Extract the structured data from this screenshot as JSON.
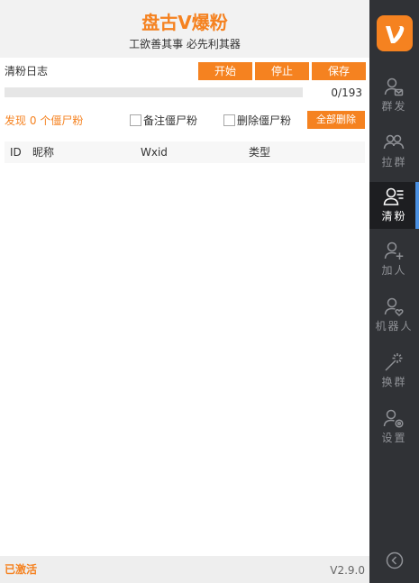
{
  "header": {
    "title": "盘古V爆粉",
    "slogan": "工欲善其事 必先利其器"
  },
  "log": {
    "label": "清粉日志",
    "start_label": "开始",
    "stop_label": "停止",
    "save_label": "保存"
  },
  "progress": {
    "current": 0,
    "total": 193,
    "text": "0/193"
  },
  "found": {
    "prefix": "发现",
    "count": "0",
    "suffix": "个僵尸粉"
  },
  "options": {
    "note_label": "备注僵尸粉",
    "delete_label": "删除僵尸粉",
    "delete_all_label": "全部删除"
  },
  "table": {
    "columns": [
      "ID",
      "昵称",
      "Wxid",
      "类型"
    ],
    "rows": []
  },
  "footer": {
    "status": "已激活",
    "version": "V2.9.0"
  },
  "sidebar": {
    "logo_icon": "v-logo-icon",
    "items": [
      {
        "label": "群发",
        "icon": "user-send-icon"
      },
      {
        "label": "拉群",
        "icon": "users-group-icon"
      },
      {
        "label": "清粉",
        "icon": "user-list-icon",
        "active": true
      },
      {
        "label": "加人",
        "icon": "user-add-icon"
      },
      {
        "label": "机器人",
        "icon": "user-heart-icon"
      },
      {
        "label": "换群",
        "icon": "magic-wand-icon"
      },
      {
        "label": "设置",
        "icon": "user-settings-icon"
      }
    ],
    "collapse_icon": "chevron-left-circle-icon"
  },
  "colors": {
    "accent": "#f58220",
    "sidebar_bg": "#303236",
    "sidebar_active_bg": "#1d1e21",
    "active_indicator": "#4a90e2"
  }
}
